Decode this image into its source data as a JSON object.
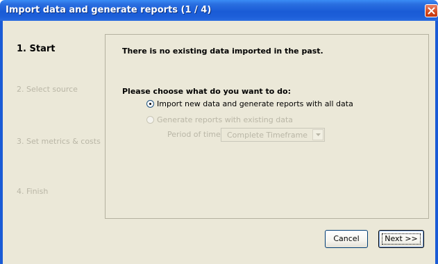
{
  "window": {
    "title": "Import data and generate reports (1 / 4)"
  },
  "steps": [
    {
      "label": "1. Start",
      "active": true
    },
    {
      "label": "2. Select source",
      "active": false
    },
    {
      "label": "3. Set metrics & costs",
      "active": false
    },
    {
      "label": "4. Finish",
      "active": false
    }
  ],
  "panel": {
    "message": "There is no existing data imported in the past.",
    "question": "Please choose what do you want to do:",
    "options": [
      {
        "label": "Import new data and generate reports with all data",
        "selected": true,
        "enabled": true
      },
      {
        "label": "Generate reports with existing data",
        "selected": false,
        "enabled": false
      }
    ],
    "period": {
      "label": "Period of time:",
      "selected_value": "Complete Timeframe"
    }
  },
  "buttons": {
    "cancel": "Cancel",
    "next": "Next >>"
  },
  "colors": {
    "titlebar": "#1a5bd6",
    "dialog_bg": "#ebe8d8",
    "disabled_text": "#b9b6a6"
  }
}
